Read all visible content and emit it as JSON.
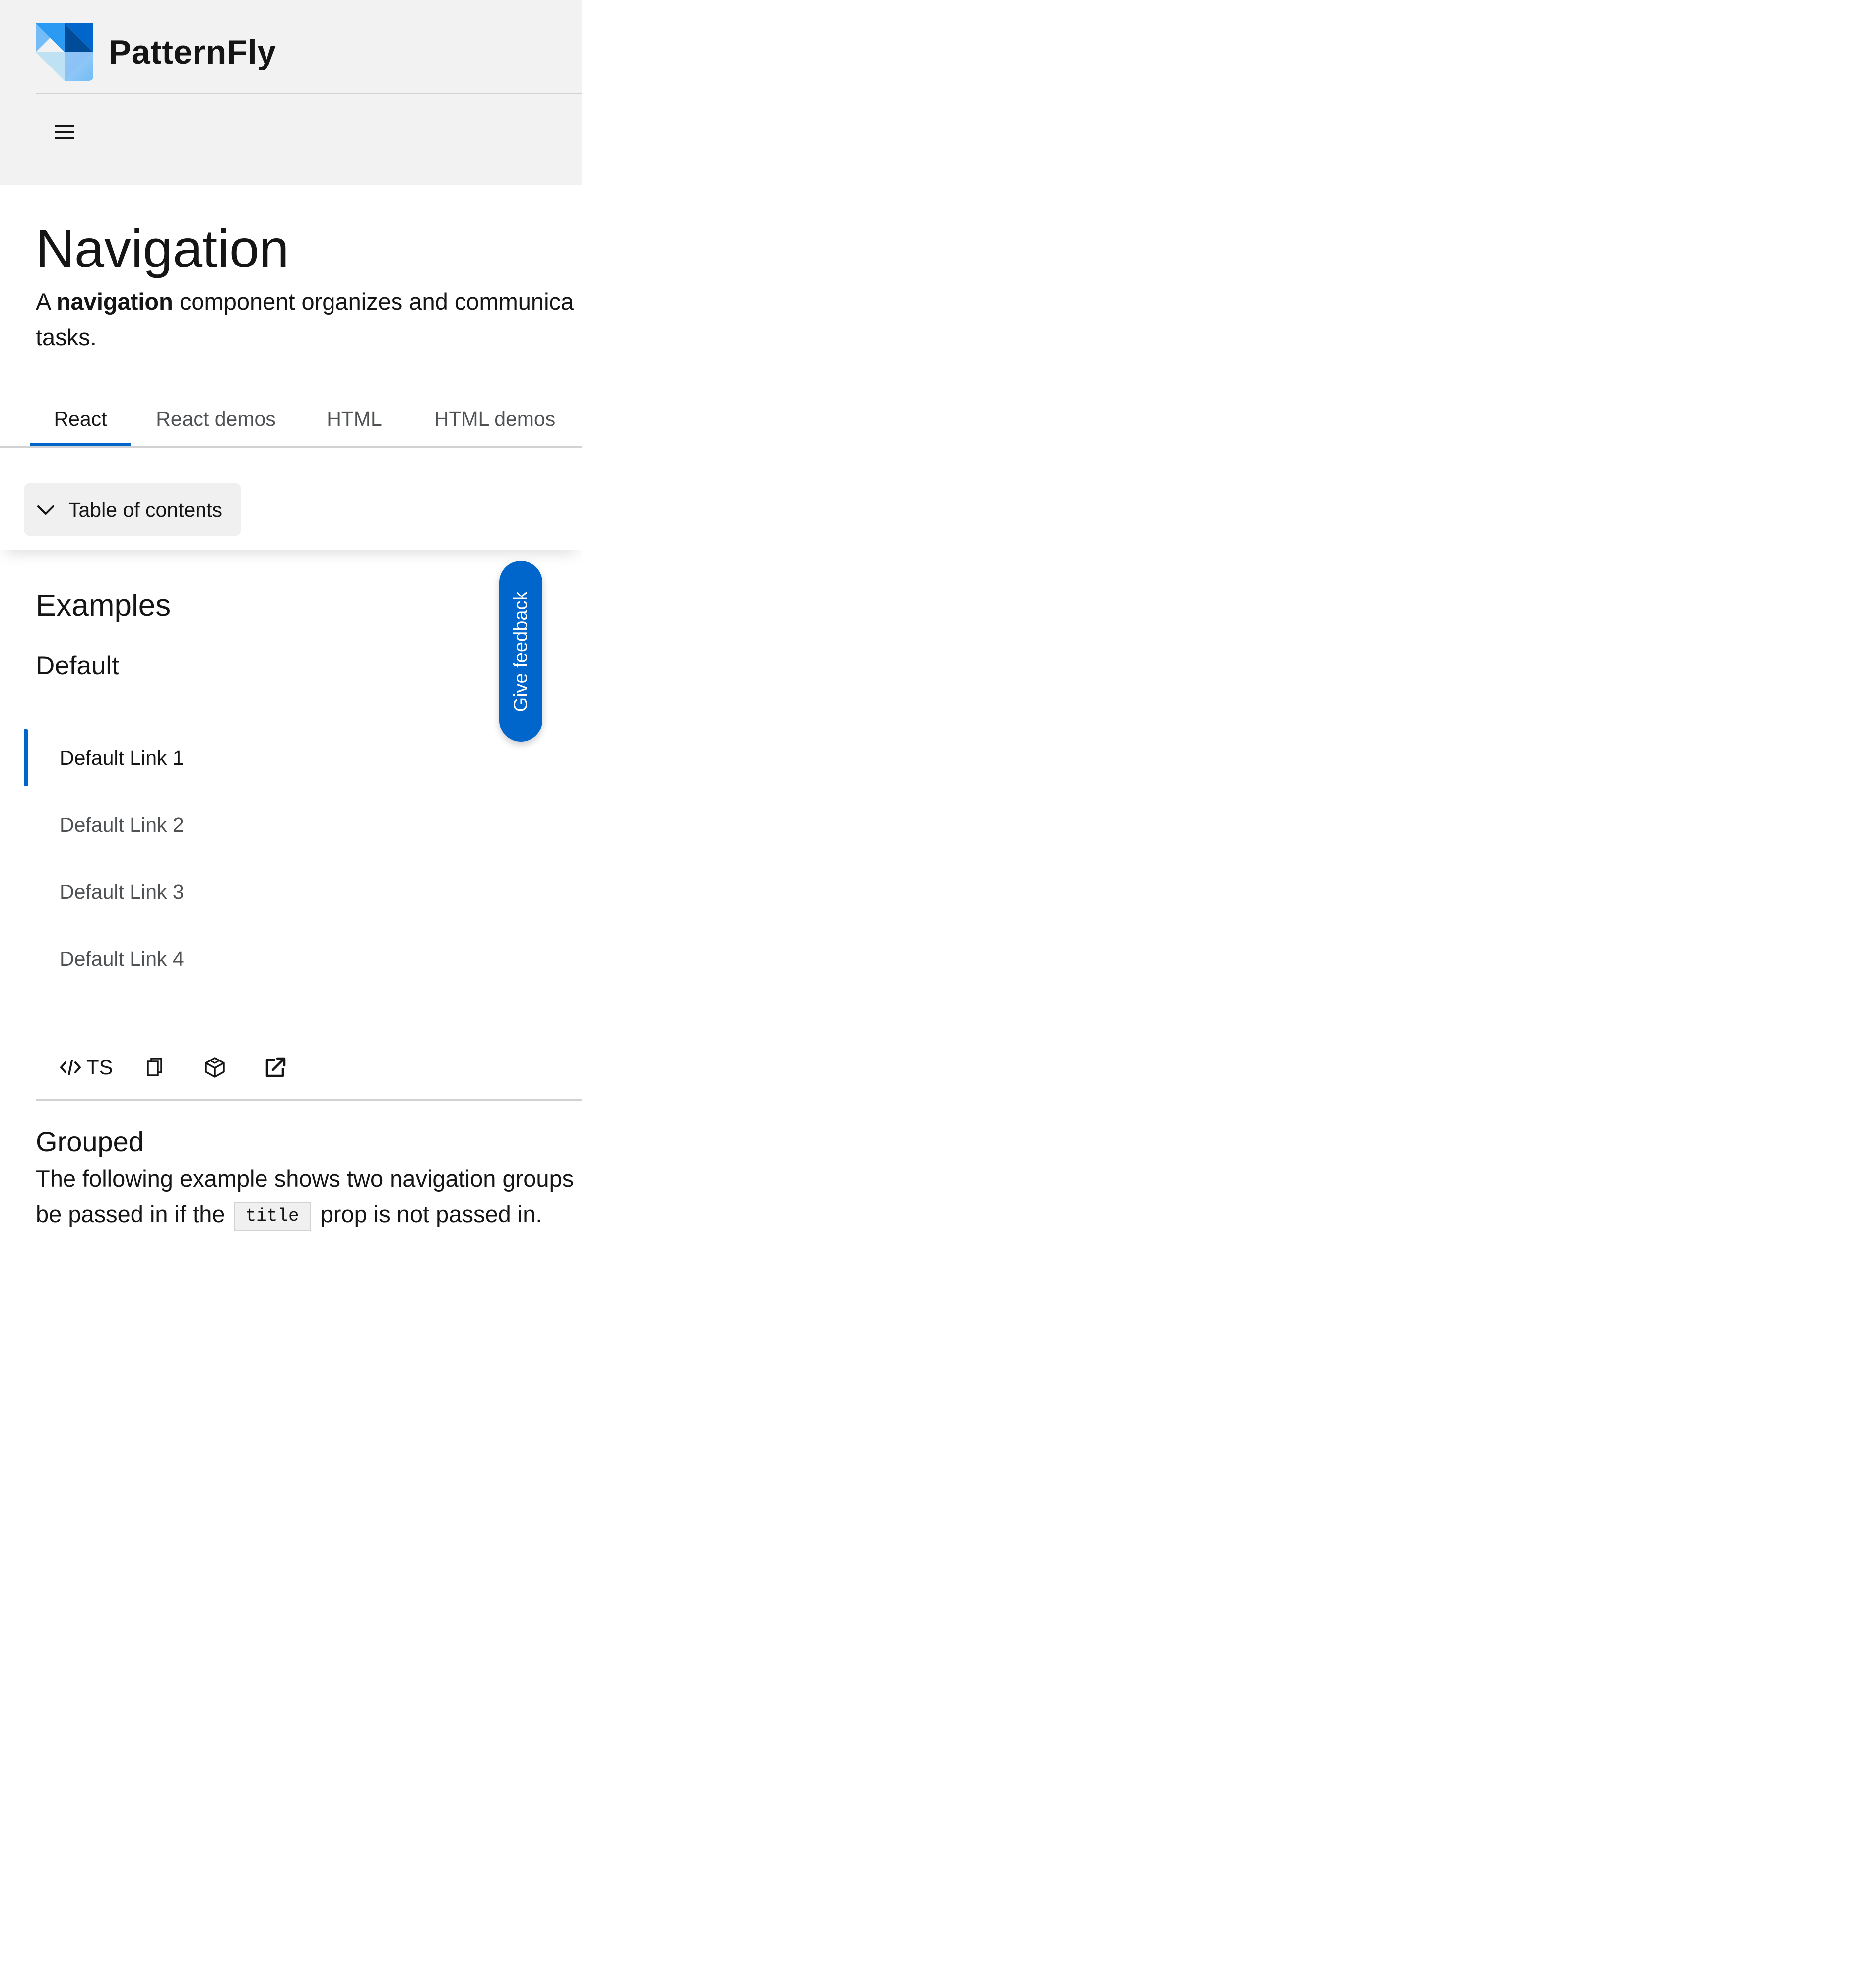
{
  "masthead": {
    "brand_name": "PatternFly",
    "menu_icon": "hamburger-menu-icon",
    "brand_colors": [
      "#0066cc",
      "#73bcf7",
      "#004080"
    ]
  },
  "page": {
    "title": "Navigation",
    "description": {
      "prefix": "A ",
      "bold": "navigation",
      "suffix": " component organizes and communica",
      "line2": "tasks."
    }
  },
  "tabs": [
    {
      "label": "React",
      "active": true
    },
    {
      "label": "React demos",
      "active": false
    },
    {
      "label": "HTML",
      "active": false
    },
    {
      "label": "HTML demos",
      "active": false
    }
  ],
  "toc": {
    "label": "Table of contents",
    "icon": "chevron-down-icon"
  },
  "feedback": {
    "label": "Give feedback"
  },
  "content": {
    "examples_heading": "Examples",
    "default_heading": "Default",
    "nav_items": [
      {
        "label": "Default Link 1",
        "current": true
      },
      {
        "label": "Default Link 2",
        "current": false
      },
      {
        "label": "Default Link 3",
        "current": false
      },
      {
        "label": "Default Link 4",
        "current": false
      }
    ],
    "toolbar": {
      "ts_label": "TS",
      "icons": [
        "code-icon",
        "copy-icon",
        "codesandbox-icon",
        "external-link-icon"
      ]
    },
    "grouped_heading": "Grouped",
    "grouped_desc": {
      "line1": "The following example shows two navigation groups",
      "line2_prefix": "be passed in if the",
      "code": "title",
      "line2_suffix": "prop is not passed in."
    }
  },
  "colors": {
    "accent": "#0066cc",
    "masthead_bg": "#f2f2f2",
    "text": "#151515",
    "muted_text": "#4f5255",
    "border": "#d2d2d2"
  }
}
